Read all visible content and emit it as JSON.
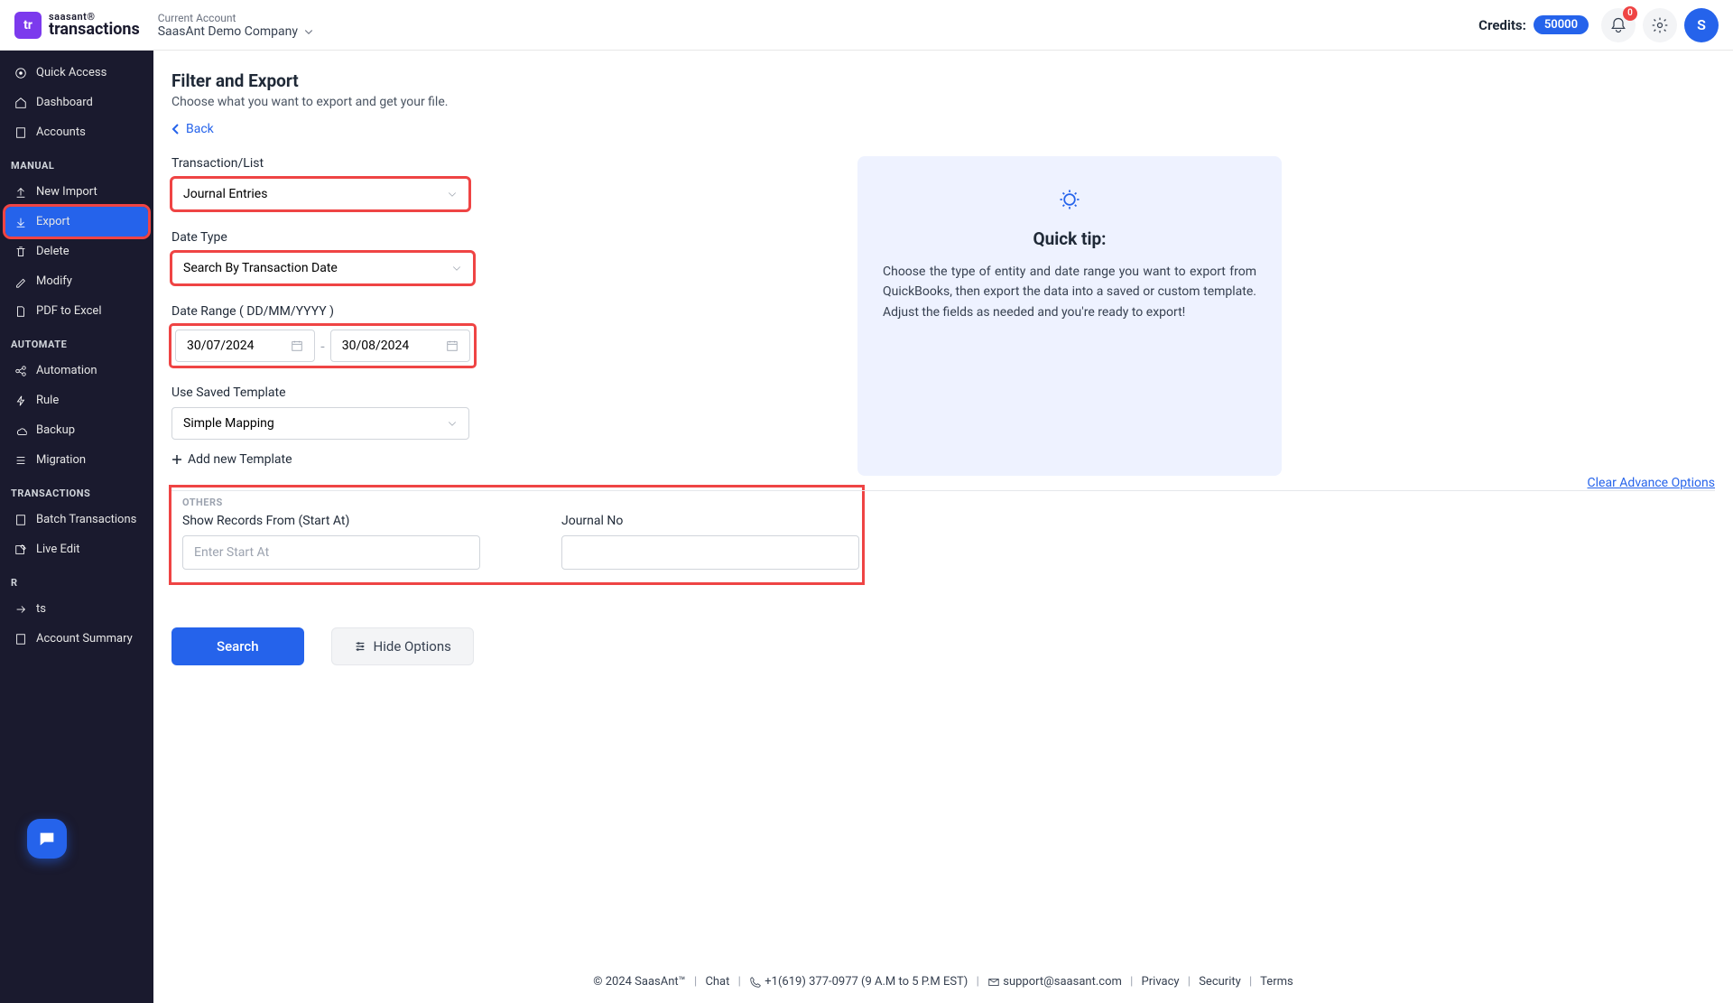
{
  "header": {
    "logo_badge": "tr",
    "logo_top": "saasant®",
    "logo_bottom": "transactions",
    "account_label": "Current Account",
    "account_name": "SaasAnt Demo Company",
    "credits_label": "Credits:",
    "credits_value": "50000",
    "notif_count": "0",
    "avatar_initial": "S"
  },
  "sidebar": {
    "quick_access": "Quick Access",
    "dashboard": "Dashboard",
    "accounts": "Accounts",
    "h_manual": "MANUAL",
    "new_import": "New Import",
    "export": "Export",
    "delete": "Delete",
    "modify": "Modify",
    "pdf_excel": "PDF to Excel",
    "h_automate": "AUTOMATE",
    "automation": "Automation",
    "rule": "Rule",
    "backup": "Backup",
    "migration": "Migration",
    "h_transactions": "TRANSACTIONS",
    "batch": "Batch Transactions",
    "live_edit": "Live Edit",
    "h_r": "R",
    "more": "ts",
    "summary": "Account Summary"
  },
  "page": {
    "title": "Filter and Export",
    "subtitle": "Choose what you want to export and get your file.",
    "back": "Back"
  },
  "form": {
    "lbl_transaction": "Transaction/List",
    "val_transaction": "Journal Entries",
    "lbl_date_type": "Date Type",
    "val_date_type": "Search By Transaction Date",
    "lbl_date_range": "Date Range ( DD/MM/YYYY )",
    "date_from": "30/07/2024",
    "date_to": "30/08/2024",
    "lbl_template": "Use Saved Template",
    "val_template": "Simple Mapping",
    "add_template": "Add new Template",
    "clear_adv": "Clear Advance Options",
    "others_hd": "OTHERS",
    "lbl_start_at": "Show Records From (Start At)",
    "ph_start_at": "Enter Start At",
    "lbl_journal_no": "Journal No",
    "btn_search": "Search",
    "btn_hide": "Hide Options"
  },
  "tip": {
    "title": "Quick tip:",
    "text": "Choose the type of entity and date range you want to export from QuickBooks, then export the data into a saved or custom template. Adjust the fields as needed and you're ready to export!"
  },
  "footer": {
    "copyright": "© 2024 SaasAnt™",
    "chat": "Chat",
    "phone": "+1(619) 377-0977 (9 A.M to 5 P.M EST)",
    "email": "support@saasant.com",
    "privacy": "Privacy",
    "security": "Security",
    "terms": "Terms"
  }
}
